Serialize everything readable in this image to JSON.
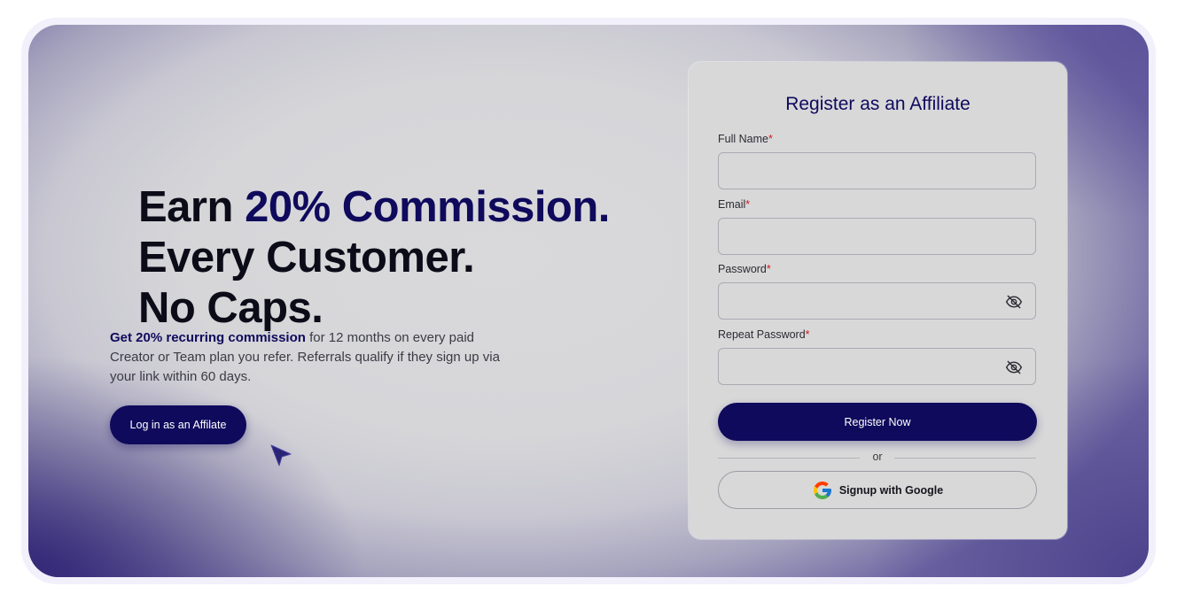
{
  "hero": {
    "headline_line1_prefix": "Earn ",
    "headline_line1_accent": "20% Commission.",
    "headline_line2": "Every Customer.",
    "headline_line3": "No Caps.",
    "description_bold": "Get 20% recurring commission",
    "description_rest": " for 12 months on every paid Creator or Team plan you refer. Referrals qualify if they sign up via your link within 60 days.",
    "login_button_label": "Log in as an Affilate"
  },
  "form": {
    "title": "Register as an Affiliate",
    "required_marker": "*",
    "fields": [
      {
        "label": "Full Name",
        "value": ""
      },
      {
        "label": "Email",
        "value": ""
      },
      {
        "label": "Password",
        "value": "",
        "icon": "eye-off-icon"
      },
      {
        "label": "Repeat Password",
        "value": "",
        "icon": "eye-off-icon"
      }
    ],
    "register_button_label": "Register Now",
    "divider_text": "or",
    "google_button_label": "Signup with Google",
    "google_icon": "google-logo-icon"
  },
  "colors": {
    "accent": "#0f0a5c",
    "required": "#cc1b1b",
    "card_background": "#d8d8d9"
  }
}
